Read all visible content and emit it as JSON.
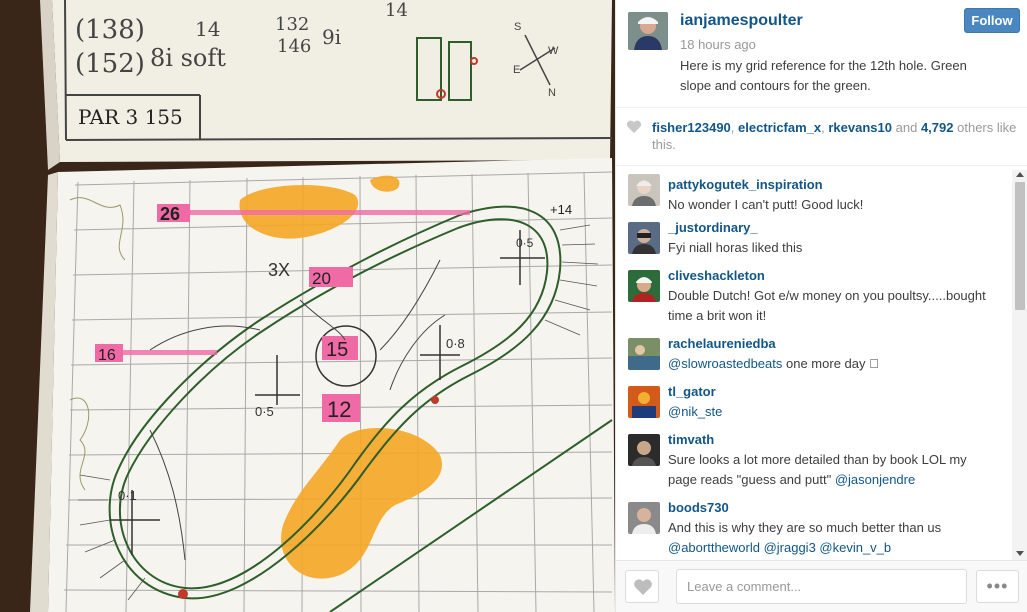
{
  "post": {
    "username": "ianjamespoulter",
    "time_ago": "18 hours ago",
    "caption": "Here is my grid reference for the 12th hole. Green slope and contours for the green.",
    "follow_label": "Follow"
  },
  "photo": {
    "yardage_top_left_1": "(138)",
    "yardage_top_left_2": "(152)",
    "note_1": "14",
    "note_2": "132",
    "note_3": "146",
    "note_4": "9i",
    "note_5": "8i soft",
    "note_6": "14",
    "par_label": "PAR 3 155",
    "compass_s": "S",
    "compass_w": "W",
    "compass_n": "N",
    "compass_e": "E",
    "label_26": "26",
    "label_20": "20",
    "label_16": "16",
    "label_15": "15",
    "label_12": "12",
    "label_plus14": "+14",
    "label_3x": "3X",
    "note_05_a": "0·5",
    "note_08": "0·8",
    "note_01": "0·1",
    "note_05_b": "0·5"
  },
  "likes": {
    "user1": "fisher123490",
    "user2": "electricfam_x",
    "user3": "rkevans10",
    "and": "and",
    "count": "4,792",
    "suffix": "others like this."
  },
  "comments": [
    {
      "user": "pattykogutek_inspiration",
      "text": "No wonder I can't putt! Good luck!",
      "mention": ""
    },
    {
      "user": "_justordinary_",
      "text": "Fyi niall horas liked this",
      "mention": ""
    },
    {
      "user": "cliveshackleton",
      "text": "Double Dutch! Got e/w money on you poultsy.....bought time a brit won it!",
      "mention": ""
    },
    {
      "user": "rachelaureniedba",
      "text": "one more day 􀀀",
      "mention": "@slowroastedbeats"
    },
    {
      "user": "tl_gator",
      "text": "",
      "mention": "@nik_ste"
    },
    {
      "user": "timvath",
      "text": "Sure looks a lot more detailed than by book LOL my page reads \"guess and putt\"",
      "mention": "@jasonjendre"
    },
    {
      "user": "boods730",
      "text": "And this is why they are so much better than us",
      "mention": "@aborttheworld @jraggi3 @kevin_v_b"
    }
  ],
  "footer": {
    "comment_placeholder": "Leave a comment...",
    "more_label": "•••"
  },
  "colors": {
    "link_blue": "#125688",
    "follow_blue": "#4a87c0",
    "bunker_orange": "#f5a623",
    "highlight_pink": "#f06aa5",
    "green_outline": "#2e5e2a"
  }
}
